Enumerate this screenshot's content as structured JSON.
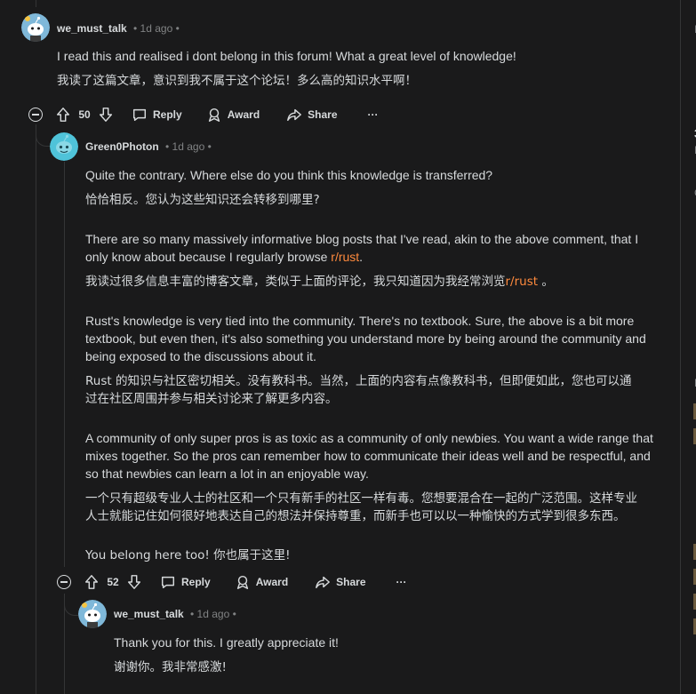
{
  "comments": [
    {
      "username": "we_must_talk",
      "time": "• 1d ago •",
      "body_en": "I read this and realised i dont belong in this forum! What a great level of knowledge!",
      "body_zh": "我读了这篇文章，意识到我不属于这个论坛！多么高的知识水平啊！",
      "votes": "50"
    },
    {
      "username": "Green0Photon",
      "time": "• 1d ago •",
      "p1_en": "Quite the contrary. Where else do you think this knowledge is transferred?",
      "p1_zh": "恰恰相反。您认为这些知识还会转移到哪里?",
      "p2_en_a": "There are so many massively informative blog posts that I've read, akin to the above comment, that I",
      "p2_en_b": "only know about because I regularly browse ",
      "p2_link": "r/rust",
      "p2_en_end": ".",
      "p2_zh_a": "我读过很多信息丰富的博客文章，类似于上面的评论，我只知道因为我经常浏览",
      "p2_zh_link": "r/rust",
      "p2_zh_end": " 。",
      "p3_en_a": "Rust's knowledge is very tied into the community. There's no textbook. Sure, the above is a bit more",
      "p3_en_b": "textbook, but even then, it's also something you understand more by being around the community and",
      "p3_en_c": "being exposed to the discussions about it.",
      "p3_zh_a": "Rust 的知识与社区密切相关。没有教科书。当然，上面的内容有点像教科书，但即便如此，您也可以通",
      "p3_zh_b": "过在社区周围并参与相关讨论来了解更多内容。",
      "p4_en_a": "A community of only super pros is as toxic as a community of only newbies. You want a wide range that",
      "p4_en_b": "mixes together. So the pros can remember how to communicate their ideas well and be respectful, and",
      "p4_en_c": "so that newbies can learn a lot in an enjoyable way.",
      "p4_zh_a": "一个只有超级专业人士的社区和一个只有新手的社区一样有毒。您想要混合在一起的广泛范围。这样专业",
      "p4_zh_b": "人士就能记住如何很好地表达自己的想法并保持尊重，而新手也可以以一种愉快的方式学到很多东西。",
      "p5": "You belong here too!  你也属于这里!",
      "votes": "52"
    },
    {
      "username": "we_must_talk",
      "time": "• 1d ago •",
      "body_en": "Thank you for this. I greatly appreciate it!",
      "body_zh": "谢谢你。我非常感激!"
    }
  ],
  "actions": {
    "reply": "Reply",
    "award": "Award",
    "share": "Share",
    "more": "···"
  },
  "sidebar_fragments": [
    "I",
    "3",
    "N",
    "C",
    "F"
  ],
  "colors": {
    "background": "#1a1a1b",
    "text": "#d7dadc",
    "meta": "#818384",
    "link": "#ff8a3d",
    "thread_line": "#343536"
  }
}
